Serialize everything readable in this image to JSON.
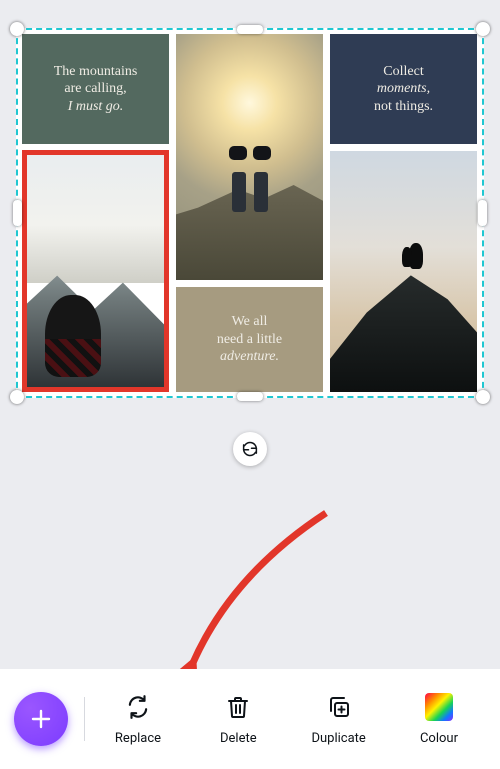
{
  "cells": {
    "mountains": {
      "line1": "The mountains",
      "line2": "are calling,",
      "line3_italic": "I must go."
    },
    "adventure": {
      "line1": "We all",
      "line2": "need a little",
      "line3_italic": "adventure."
    },
    "collect": {
      "line1": "Collect",
      "line2_italic": "moments,",
      "line3": "not things."
    }
  },
  "toolbar": {
    "replace": "Replace",
    "delete": "Delete",
    "duplicate": "Duplicate",
    "colour": "Colour"
  },
  "colors": {
    "selection": "#20c7d1",
    "highlight": "#e2362a",
    "cell_green": "#53695f",
    "cell_sand": "#a69b80",
    "cell_navy": "#2f3c54"
  }
}
